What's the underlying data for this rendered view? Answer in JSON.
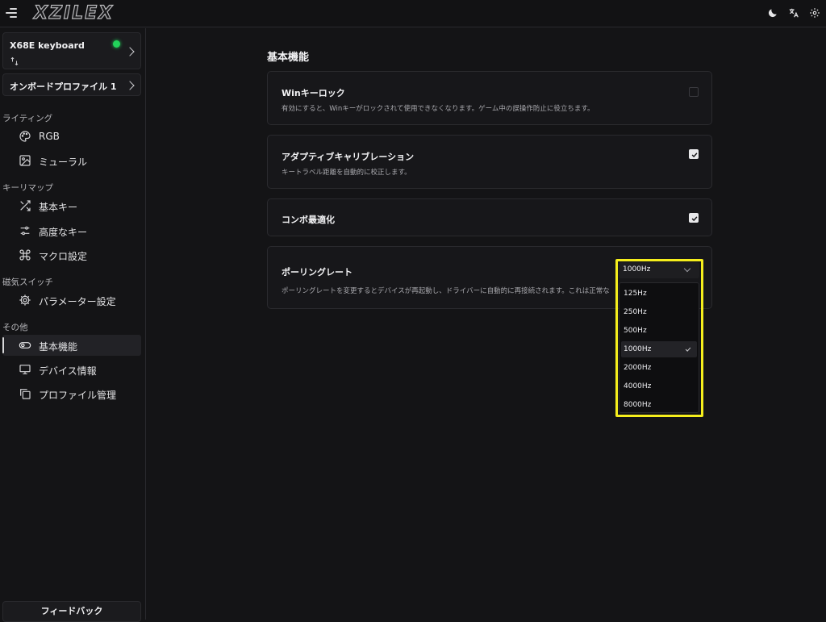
{
  "app": {
    "logo": "XZILEX"
  },
  "device": {
    "name": "X68E keyboard",
    "status_color": "#22d35a"
  },
  "profile": {
    "label": "オンボードプロファイル 1"
  },
  "sidebar": {
    "sections": [
      {
        "heading": "ライティング",
        "items": [
          {
            "label": "RGB",
            "icon": "palette-icon"
          },
          {
            "label": "ミューラル",
            "icon": "image-icon"
          }
        ]
      },
      {
        "heading": "キーリマップ",
        "items": [
          {
            "label": "基本キー",
            "icon": "shuffle-icon"
          },
          {
            "label": "高度なキー",
            "icon": "sliders-icon"
          },
          {
            "label": "マクロ設定",
            "icon": "command-icon"
          }
        ]
      },
      {
        "heading": "磁気スイッチ",
        "items": [
          {
            "label": "パラメーター設定",
            "icon": "gear-icon"
          }
        ]
      },
      {
        "heading": "その他",
        "items": [
          {
            "label": "基本機能",
            "icon": "toggle-icon",
            "active": true
          },
          {
            "label": "デバイス情報",
            "icon": "monitor-icon"
          },
          {
            "label": "プロファイル管理",
            "icon": "copy-icon"
          }
        ]
      }
    ],
    "feedback_label": "フィードバック"
  },
  "main": {
    "title": "基本機能",
    "cards": [
      {
        "title": "Winキーロック",
        "description": "有効にすると、Winキーがロックされて使用できなくなります。ゲーム中の誤操作防止に役立ちます。",
        "checked": false
      },
      {
        "title": "アダプティブキャリブレーション",
        "description": "キートラベル距離を自動的に校正します。",
        "checked": true
      },
      {
        "title": "コンボ最適化",
        "description": "",
        "checked": true
      },
      {
        "title": "ポーリングレート",
        "description": "ポーリングレートを変更するとデバイスが再起動し、ドライバーに自動的に再接続されます。これは正常な"
      }
    ],
    "polling": {
      "selected": "1000Hz",
      "options": [
        "125Hz",
        "250Hz",
        "500Hz",
        "1000Hz",
        "2000Hz",
        "4000Hz",
        "8000Hz"
      ]
    }
  },
  "colors": {
    "highlight": "#f5ee1c",
    "accent_on": "#22d35a"
  }
}
